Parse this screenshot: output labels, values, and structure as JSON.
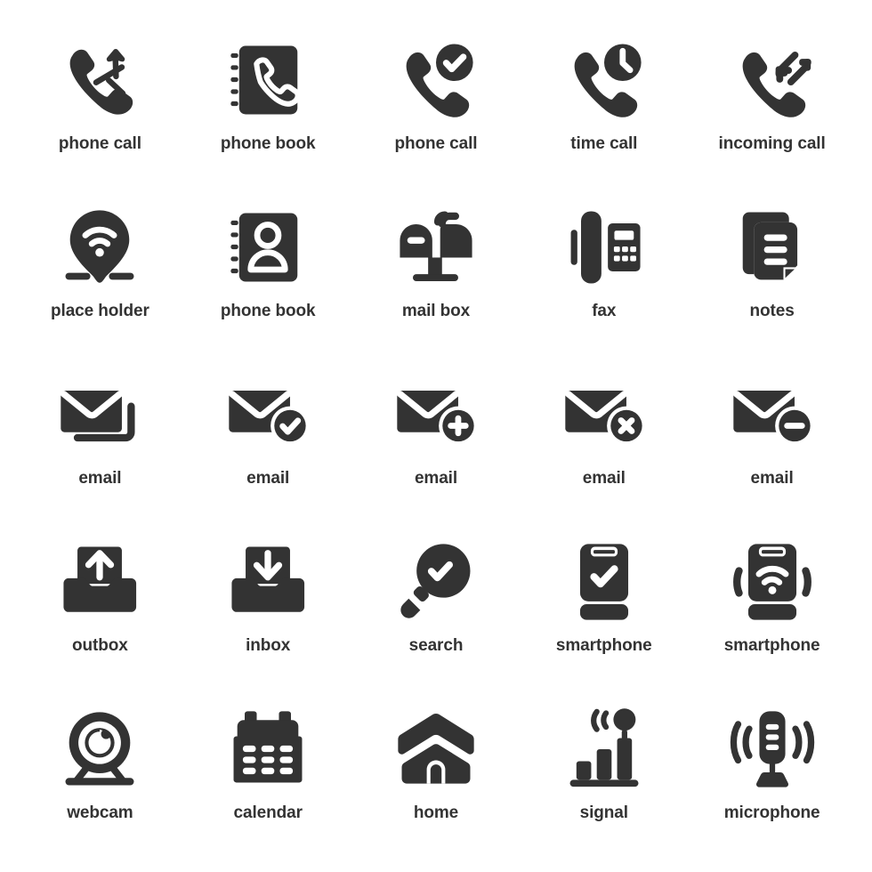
{
  "sheet": {
    "background_color": "#ffffff",
    "icon_color": "#333333",
    "label_color": "#333333",
    "columns": 5,
    "rows": 5
  },
  "icons": [
    {
      "id": "phone-call-outgoing",
      "label": "phone call",
      "glyph": "handset-arrow"
    },
    {
      "id": "phone-book-handset",
      "label": "phone book",
      "glyph": "book-handset"
    },
    {
      "id": "phone-call-check",
      "label": "phone call",
      "glyph": "handset-check"
    },
    {
      "id": "time-call",
      "label": "time call",
      "glyph": "handset-clock"
    },
    {
      "id": "incoming-call",
      "label": "incoming call",
      "glyph": "handset-incoming"
    },
    {
      "id": "place-holder",
      "label": "place holder",
      "glyph": "pin-wifi"
    },
    {
      "id": "phone-book-person",
      "label": "phone book",
      "glyph": "book-person"
    },
    {
      "id": "mail-box",
      "label": "mail box",
      "glyph": "mailbox"
    },
    {
      "id": "fax",
      "label": "fax",
      "glyph": "fax-machine"
    },
    {
      "id": "notes",
      "label": "notes",
      "glyph": "note-pages"
    },
    {
      "id": "email-stack",
      "label": "email",
      "glyph": "envelope-stack"
    },
    {
      "id": "email-check",
      "label": "email",
      "glyph": "envelope-check"
    },
    {
      "id": "email-add",
      "label": "email",
      "glyph": "envelope-plus"
    },
    {
      "id": "email-remove",
      "label": "email",
      "glyph": "envelope-cross"
    },
    {
      "id": "email-minus",
      "label": "email",
      "glyph": "envelope-minus"
    },
    {
      "id": "outbox",
      "label": "outbox",
      "glyph": "tray-up"
    },
    {
      "id": "inbox",
      "label": "inbox",
      "glyph": "tray-down"
    },
    {
      "id": "search",
      "label": "search",
      "glyph": "magnifier-check"
    },
    {
      "id": "smartphone-check",
      "label": "smartphone",
      "glyph": "phone-check"
    },
    {
      "id": "smartphone-wifi",
      "label": "smartphone",
      "glyph": "phone-wifi"
    },
    {
      "id": "webcam",
      "label": "webcam",
      "glyph": "webcam-stand"
    },
    {
      "id": "calendar",
      "label": "calendar",
      "glyph": "calendar-grid"
    },
    {
      "id": "home",
      "label": "home",
      "glyph": "house"
    },
    {
      "id": "signal",
      "label": "signal",
      "glyph": "signal-bars"
    },
    {
      "id": "microphone",
      "label": "microphone",
      "glyph": "mic-stand"
    }
  ]
}
